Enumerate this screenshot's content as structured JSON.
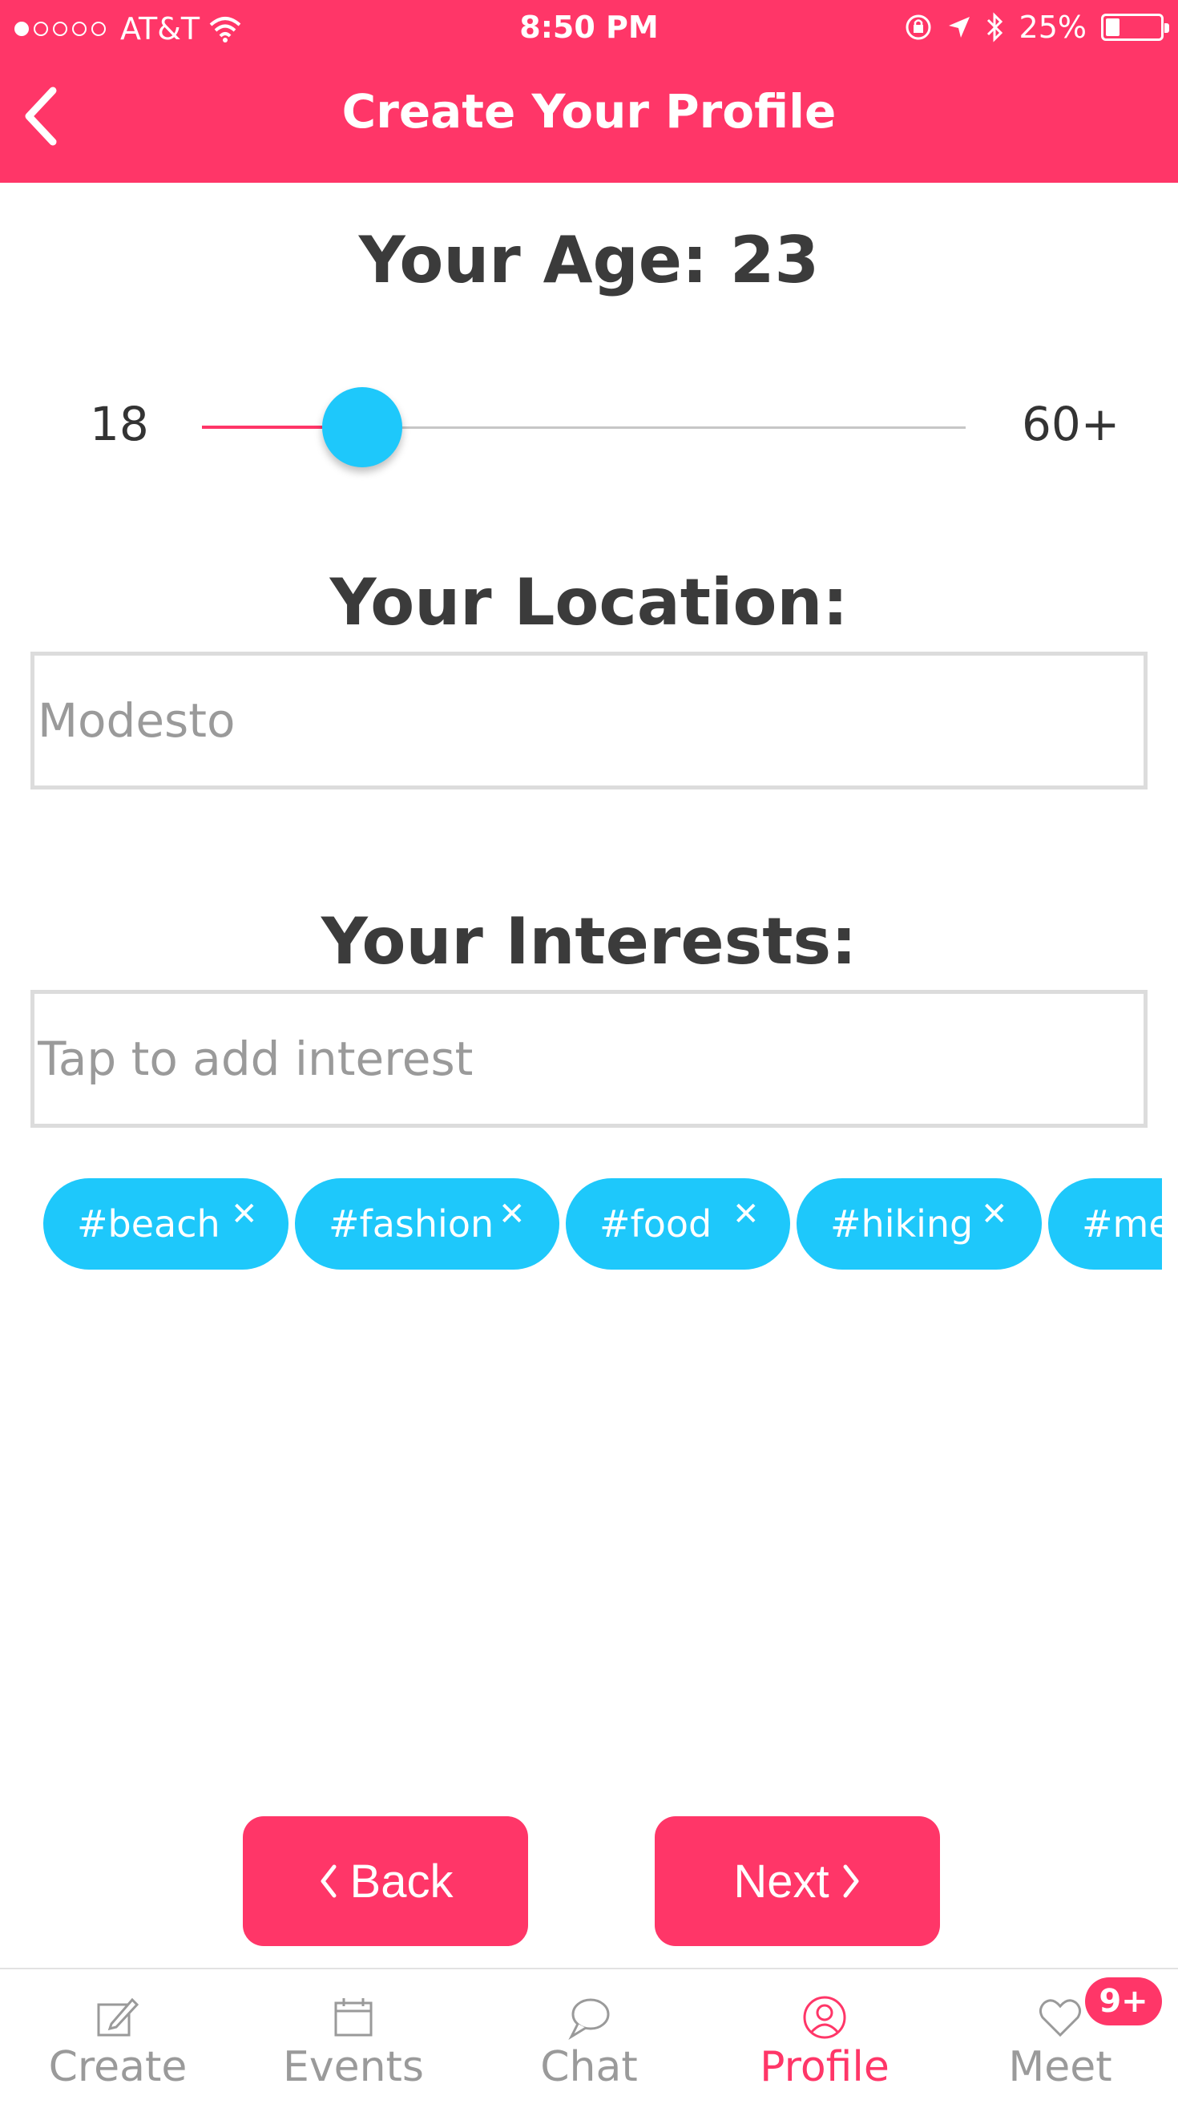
{
  "status_bar": {
    "carrier": "AT&T",
    "time": "8:50 PM",
    "battery": "25%",
    "battery_level": 0.25,
    "signal_bars_filled": 1,
    "signal_bars_total": 5
  },
  "nav": {
    "title": "Create Your Profile",
    "back_icon": "chevron-left-icon"
  },
  "age": {
    "title": "Your Age: 23",
    "min_label": "18",
    "max_label": "60+",
    "value": 23,
    "min": 18,
    "max": 60
  },
  "location": {
    "title": "Your Location:",
    "placeholder": "Modesto",
    "value": ""
  },
  "interests": {
    "title": "Your Interests:",
    "placeholder": "Tap to add interest",
    "tags": [
      "#beach",
      "#fashion",
      "#food",
      "#hiking",
      "#med"
    ]
  },
  "buttons": {
    "back": "Back",
    "next": "Next"
  },
  "tabbar": {
    "items": [
      {
        "label": "Create",
        "icon": "pencil-square-icon"
      },
      {
        "label": "Events",
        "icon": "calendar-icon"
      },
      {
        "label": "Chat",
        "icon": "chat-bubble-icon"
      },
      {
        "label": "Profile",
        "icon": "user-circle-icon"
      },
      {
        "label": "Meet",
        "icon": "heart-icon"
      }
    ],
    "active": "Profile",
    "meet_badge": "9+"
  },
  "colors": {
    "brand_pink": "#ff3668",
    "accent_blue": "#1ec8fb",
    "text_dark": "#3b3b3b",
    "text_gray": "#9a9a9a"
  }
}
